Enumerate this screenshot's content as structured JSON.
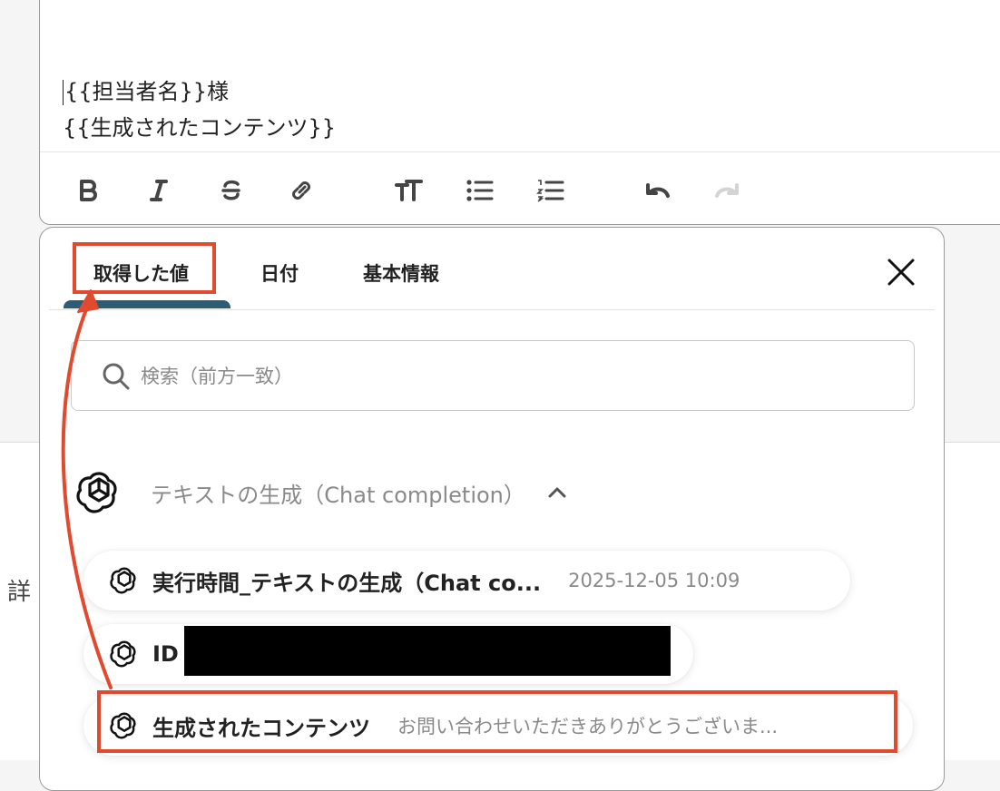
{
  "editor": {
    "line1": "{{担当者名}}様",
    "line2": "{{生成されたコンテンツ}}",
    "toolbar": {
      "bold_icon": "bold-icon",
      "italic_icon": "italic-icon",
      "strikethrough_icon": "strikethrough-icon",
      "link_icon": "link-icon",
      "text_size_icon": "text-size-icon",
      "bullet_list_icon": "bullet-list-icon",
      "ordered_list_icon": "ordered-list-icon",
      "undo_icon": "undo-icon",
      "redo_icon": "redo-icon"
    }
  },
  "left_label": "詳",
  "popup": {
    "tabs": [
      {
        "label": "取得した値",
        "active": true
      },
      {
        "label": "日付",
        "active": false
      },
      {
        "label": "基本情報",
        "active": false
      }
    ],
    "close_icon": "close-icon",
    "search": {
      "placeholder": "検索（前方一致）",
      "value": ""
    },
    "group": {
      "icon": "openai-icon",
      "title": "テキストの生成（Chat completion）",
      "expanded": true
    },
    "items": [
      {
        "label": "実行時間_テキストの生成（Chat co...",
        "value": "2025-12-05 10:09"
      },
      {
        "label": "ID",
        "value": ""
      },
      {
        "label": "生成されたコンテンツ",
        "value": "お問い合わせいただきありがとうございま..."
      }
    ]
  },
  "colors": {
    "active_tab": "#2d5c75",
    "highlight": "#e04a2f",
    "muted_text": "#8a8a8a"
  }
}
